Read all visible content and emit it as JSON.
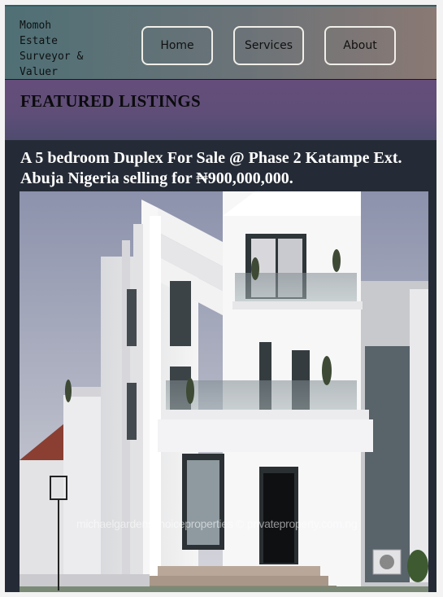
{
  "brand": {
    "name": "Momoh\nEstate\nSurveyor &\nValuer"
  },
  "nav": {
    "items": [
      {
        "label": "Home"
      },
      {
        "label": "Services"
      },
      {
        "label": "About"
      }
    ]
  },
  "featured": {
    "title": "FEATURED LISTINGS"
  },
  "listing": {
    "title": "A 5 bedroom Duplex For Sale @ Phase 2 Katampe Ext. Abuja Nigeria selling for ₦900,000,000.",
    "photo_watermark": "michaelgardenschoiceproperties © privateproperty.com.ng"
  },
  "colors": {
    "header_left": "#4f7075",
    "header_right": "#8a7974",
    "featured_band": "#5f4e78",
    "listing_bg": "#252b36",
    "nav_border": "#f0eee8"
  }
}
